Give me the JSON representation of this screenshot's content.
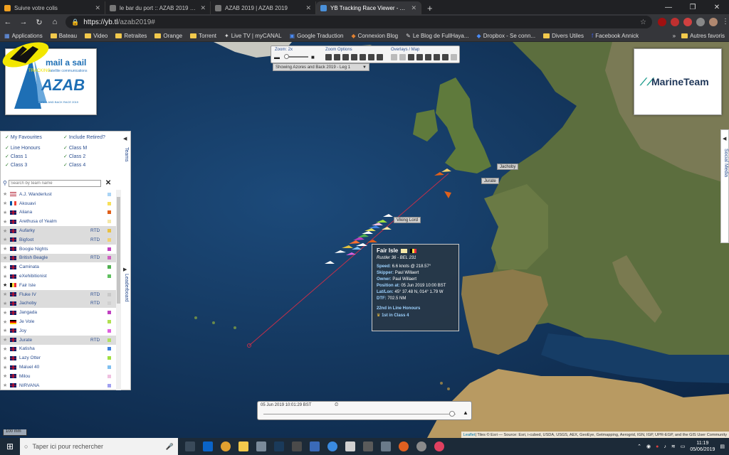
{
  "browser": {
    "tabs": [
      {
        "title": "Suivre votre colis",
        "icon": "amazon-icon",
        "active": false
      },
      {
        "title": "le bar du port :: AZAB 2019 une ·",
        "icon": "globe-icon",
        "active": false
      },
      {
        "title": "AZAB 2019 | AZAB 2019",
        "icon": "globe-icon",
        "active": false
      },
      {
        "title": "YB Tracking Race Viewer - Azores",
        "icon": "globe-icon",
        "active": true
      }
    ],
    "url_host": "https://yb.tl",
    "url_path": "/azab2019#",
    "bookmarks": [
      "Applications",
      "Bateau",
      "Video",
      "Retraites",
      "Orange",
      "Torrent",
      "Live TV | myCANAL",
      "Google Traduction",
      "Connexion Blog",
      "Le Blog de FullHaya...",
      "Dropbox - Se conn...",
      "Divers Utiles",
      "Facebook Annick"
    ],
    "bookmarks_more": "»",
    "bookmarks_other": "Autres favoris"
  },
  "logos": {
    "azab_brand": "mail a sail",
    "azab_sub": "satellite communications",
    "azab_big": "AZAB",
    "azab_tag": "AZORES AND BACK RACE 2019",
    "marine": "MarineTeam"
  },
  "controls": {
    "zoom_label": "Zoom: 2x",
    "zoom_options": "Zoom Options",
    "overlays": "Overlays / Map",
    "showing": "Showing Azores and Back 2019 - Leg 1"
  },
  "filters": {
    "my_favourites": "My Favourites",
    "include_retired": "Include Retired?",
    "line_honours": "Line Honours",
    "class_m": "Class M",
    "class_1": "Class 1",
    "class_2": "Class 2",
    "class_3": "Class 3",
    "class_4": "Class 4",
    "teams_tab": "Teams",
    "leaderboard_tab": "Leaderboard",
    "search_placeholder": "Search by team name"
  },
  "teams": [
    {
      "name": "A.J. Wanderlust",
      "flag": "us",
      "status": "",
      "color": "#aad4f5",
      "fav": false
    },
    {
      "name": "Akouavi",
      "flag": "fr",
      "status": "",
      "color": "#f7e05a",
      "fav": false
    },
    {
      "name": "Aliana",
      "flag": "gb",
      "status": "",
      "color": "#e0601a",
      "fav": false
    },
    {
      "name": "Arethusa of Yealm",
      "flag": "gb",
      "status": "",
      "color": "#f5e8a8",
      "fav": false
    },
    {
      "name": "Aufarky",
      "flag": "gb",
      "status": "RTD",
      "color": "#e8c040",
      "fav": false
    },
    {
      "name": "Bigfoot",
      "flag": "gb",
      "status": "RTD",
      "color": "#f0d070",
      "fav": false
    },
    {
      "name": "Boogie Nights",
      "flag": "gb",
      "status": "",
      "color": "#c040c0",
      "fav": false
    },
    {
      "name": "British Beagle",
      "flag": "gb",
      "status": "RTD",
      "color": "#d060c0",
      "fav": false
    },
    {
      "name": "Caminata",
      "flag": "gb",
      "status": "",
      "color": "#50b050",
      "fav": false
    },
    {
      "name": "eXehibitionist",
      "flag": "gb",
      "status": "",
      "color": "#60c060",
      "fav": false
    },
    {
      "name": "Fair Isle",
      "flag": "be",
      "status": "",
      "color": "#ffffff",
      "fav": true
    },
    {
      "name": "Fluke IV",
      "flag": "gb",
      "status": "RTD",
      "color": "#c8c8c8",
      "fav": false
    },
    {
      "name": "Jachoby",
      "flag": "gb",
      "status": "RTD",
      "color": "#d0d0d0",
      "fav": false
    },
    {
      "name": "Jangada",
      "flag": "gb",
      "status": "",
      "color": "#c040c0",
      "fav": false
    },
    {
      "name": "Je Vole",
      "flag": "de",
      "status": "",
      "color": "#b0e050",
      "fav": false
    },
    {
      "name": "Joy",
      "flag": "gb",
      "status": "",
      "color": "#e060e0",
      "fav": false
    },
    {
      "name": "Jurate",
      "flag": "gb",
      "status": "RTD",
      "color": "#b0e060",
      "fav": false
    },
    {
      "name": "Katisha",
      "flag": "gb",
      "status": "",
      "color": "#4080e0",
      "fav": false
    },
    {
      "name": "Lazy Otter",
      "flag": "gb",
      "status": "",
      "color": "#a0e040",
      "fav": false
    },
    {
      "name": "Maluel 40",
      "flag": "gb",
      "status": "",
      "color": "#80c0f0",
      "fav": false
    },
    {
      "name": "Milou",
      "flag": "gb",
      "status": "",
      "color": "#f0c0e0",
      "fav": false
    },
    {
      "name": "NIRVANA",
      "flag": "gb",
      "status": "",
      "color": "#a0a0f0",
      "fav": false
    }
  ],
  "popup": {
    "name": "Fair Isle",
    "subtitle": "Rustler 36 - BEL 231",
    "speed_k": "Speed:",
    "speed_v": "6.6 knots @ 218.57°",
    "skipper_k": "Skipper:",
    "skipper_v": "Paul Willaert",
    "owner_k": "Owner:",
    "owner_v": "Paul Willaert",
    "position_k": "Position at:",
    "position_v": "05 Jun 2019 10:00 BST",
    "latlon_k": "Lat/Lon:",
    "latlon_v": "45° 37.48 N, 014° 1.79 W",
    "dtf_k": "DTF:",
    "dtf_v": "702.5 NM",
    "rank1": "22nd in Line Honours",
    "rank2": "1st in Class 4"
  },
  "map_labels": {
    "viking": "Viking Lord",
    "jachoby": "Jachoby",
    "jurate": "Jurate"
  },
  "timeline": {
    "date": "05 Jun 2019 10:01:29 BST",
    "position_fraction": 0.98
  },
  "scale": "100 mm",
  "social": "Social Media",
  "attribution_link": "Leaflet",
  "attribution": " | Tiles © Esri — Source: Esri, i-cubed, USDA, USGS, AEX, GeoEye, Getmapping, Aerogrid, IGN, IGP, UPR-EGP, and the GIS User Community",
  "yb_logo": "TRACKING",
  "taskbar": {
    "search": "Taper ici pour rechercher",
    "time": "11:19",
    "date": "05/06/2019"
  }
}
